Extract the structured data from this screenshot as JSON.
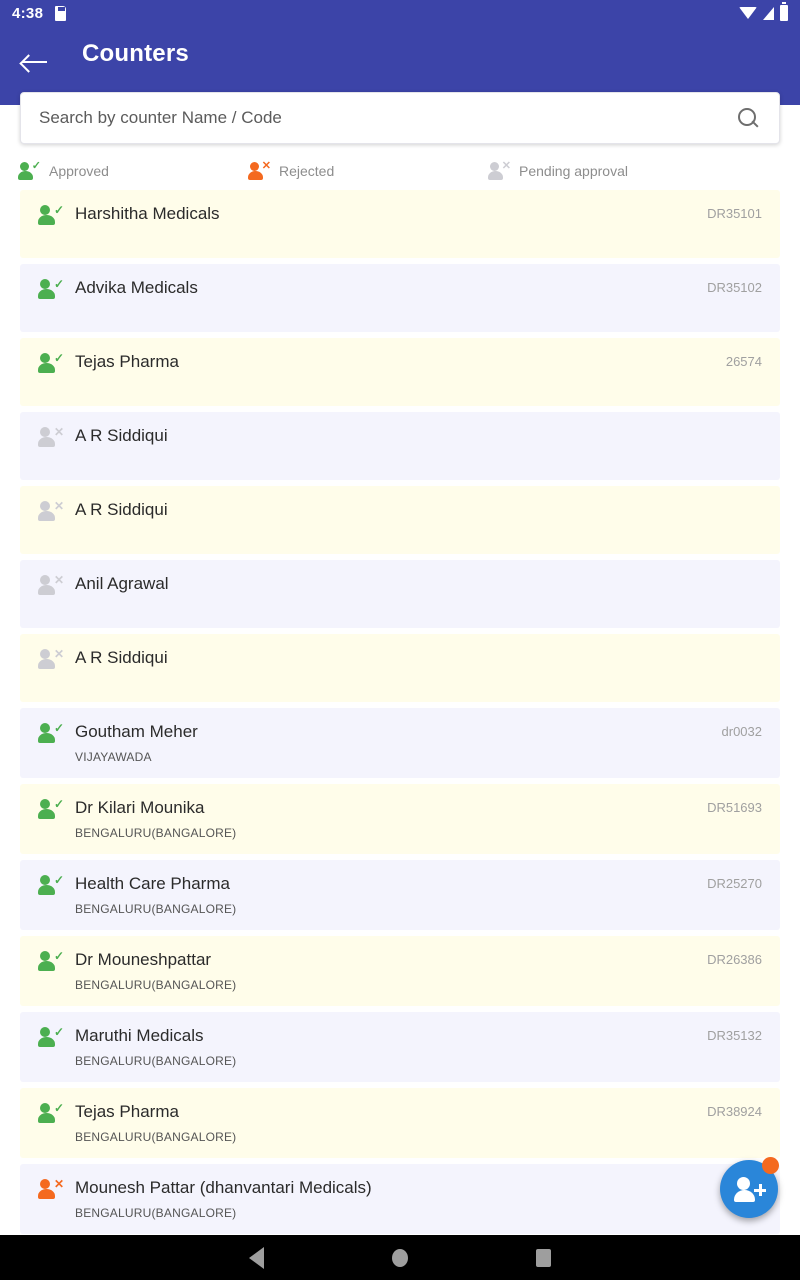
{
  "statusbar": {
    "time": "4:38",
    "icons": [
      "sd-card-icon",
      "wifi-icon",
      "signal-icon",
      "battery-icon"
    ]
  },
  "appbar": {
    "title": "Counters",
    "back_icon": "arrow-left-icon",
    "background_color": "#3c44a8"
  },
  "search": {
    "placeholder": "Search by counter Name / Code",
    "value": "",
    "icon": "search-icon"
  },
  "legend": [
    {
      "label": "Approved",
      "status": "approved",
      "icon": "person-check-icon",
      "color": "#4caf50",
      "mark": "✓"
    },
    {
      "label": "Rejected",
      "status": "rejected",
      "icon": "person-x-icon",
      "color": "#f4691f",
      "mark": "✕"
    },
    {
      "label": "Pending approval",
      "status": "pending",
      "icon": "person-x-icon",
      "color": "#cdcdd3",
      "mark": "✕"
    }
  ],
  "colors": {
    "header": "#3c44a8",
    "row_cream": "#fffdea",
    "row_lavender": "#f4f4fd",
    "approved": "#4caf50",
    "rejected": "#f4691f",
    "pending": "#cdcdd3",
    "fab": "#2a86d9",
    "fab_badge": "#f4691f"
  },
  "counters": [
    {
      "name": "Harshitha Medicals",
      "city": "",
      "code": "DR35101",
      "status": "approved",
      "row_bg": "cream"
    },
    {
      "name": "Advika Medicals",
      "city": "",
      "code": "DR35102",
      "status": "approved",
      "row_bg": "lav"
    },
    {
      "name": "Tejas Pharma",
      "city": "",
      "code": "26574",
      "status": "approved",
      "row_bg": "cream"
    },
    {
      "name": "A R Siddiqui",
      "city": "",
      "code": "",
      "status": "pending",
      "row_bg": "lav"
    },
    {
      "name": "A R Siddiqui",
      "city": "",
      "code": "",
      "status": "pending",
      "row_bg": "cream"
    },
    {
      "name": "Anil Agrawal",
      "city": "",
      "code": "",
      "status": "pending",
      "row_bg": "lav"
    },
    {
      "name": "A R Siddiqui",
      "city": "",
      "code": "",
      "status": "pending",
      "row_bg": "cream"
    },
    {
      "name": "Goutham Meher",
      "city": "VIJAYAWADA",
      "code": "dr0032",
      "status": "approved",
      "row_bg": "lav"
    },
    {
      "name": "Dr  Kilari Mounika",
      "city": "BENGALURU(BANGALORE)",
      "code": "DR51693",
      "status": "approved",
      "row_bg": "cream"
    },
    {
      "name": "Health Care Pharma",
      "city": "BENGALURU(BANGALORE)",
      "code": "DR25270",
      "status": "approved",
      "row_bg": "lav"
    },
    {
      "name": "Dr Mouneshpattar",
      "city": "BENGALURU(BANGALORE)",
      "code": "DR26386",
      "status": "approved",
      "row_bg": "cream"
    },
    {
      "name": "Maruthi Medicals",
      "city": "BENGALURU(BANGALORE)",
      "code": "DR35132",
      "status": "approved",
      "row_bg": "lav"
    },
    {
      "name": "Tejas Pharma",
      "city": "BENGALURU(BANGALORE)",
      "code": "DR38924",
      "status": "approved",
      "row_bg": "cream"
    },
    {
      "name": "Mounesh Pattar (dhanvantari Medicals)",
      "city": "BENGALURU(BANGALORE)",
      "code": "",
      "status": "rejected",
      "row_bg": "lav"
    }
  ],
  "fab": {
    "icon": "add-person-icon",
    "badge": true
  },
  "navbar": {
    "back": "triangle-back-icon",
    "home": "circle-home-icon",
    "recents": "square-recents-icon"
  }
}
